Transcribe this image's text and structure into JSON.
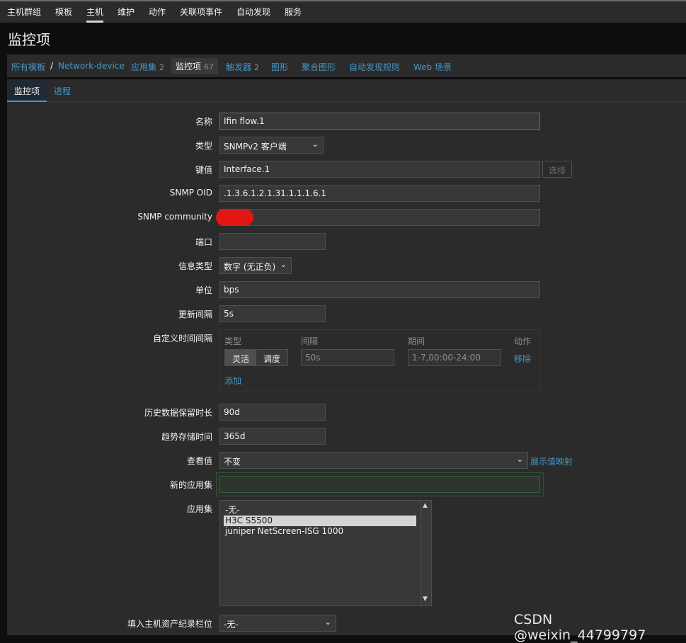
{
  "topnav": {
    "items": [
      "主机群组",
      "模板",
      "主机",
      "维护",
      "动作",
      "关联项事件",
      "自动发现",
      "服务"
    ],
    "active": "主机"
  },
  "page_title": "监控项",
  "breadcrumb": {
    "all_templates": "所有模板",
    "separator": "/",
    "template": "Network-device",
    "applications": "应用集",
    "applications_count": "2",
    "items": "监控项",
    "items_count": "67",
    "triggers": "触发器",
    "triggers_count": "2",
    "graphs": "图形",
    "screens": "聚合图形",
    "discovery": "自动发现规则",
    "web": "Web 场景"
  },
  "tabs": [
    "监控项",
    "进程"
  ],
  "form": {
    "name": {
      "label": "名称",
      "value": "Ifin flow.1"
    },
    "type": {
      "label": "类型",
      "value": "SNMPv2 客户端"
    },
    "key": {
      "label": "键值",
      "value": "Interface.1",
      "select_button": "选择"
    },
    "snmp_oid": {
      "label": "SNMP OID",
      "value": ".1.3.6.1.2.1.31.1.1.1.6.1"
    },
    "snmp_community": {
      "label": "SNMP community",
      "value": ""
    },
    "port": {
      "label": "端口",
      "value": ""
    },
    "value_type": {
      "label": "信息类型",
      "value": "数字 (无正负)"
    },
    "units": {
      "label": "单位",
      "value": "bps"
    },
    "update_interval": {
      "label": "更新间隔",
      "value": "5s"
    },
    "custom_intervals": {
      "label": "自定义时间间隔",
      "headers": {
        "type": "类型",
        "interval": "间隔",
        "period": "期间",
        "action": "动作"
      },
      "seg_flexible": "灵活",
      "seg_scheduling": "调度",
      "interval_value": "50s",
      "period_value": "1-7,00:00-24:00",
      "remove": "移除",
      "add": "添加"
    },
    "history": {
      "label": "历史数据保留时长",
      "value": "90d"
    },
    "trends": {
      "label": "趋势存储时间",
      "value": "365d"
    },
    "show_value": {
      "label": "查看值",
      "value": "不变",
      "link": "展示值映射"
    },
    "new_application": {
      "label": "新的应用集",
      "value": ""
    },
    "applications": {
      "label": "应用集",
      "options": [
        "-无-",
        "H3C S5500",
        "juniper NetScreen-ISG 1000"
      ],
      "selected_index": 1
    },
    "inventory": {
      "label": "填入主机资产纪录栏位",
      "value": "-无-"
    }
  },
  "watermark": "CSDN @weixin_44799797"
}
